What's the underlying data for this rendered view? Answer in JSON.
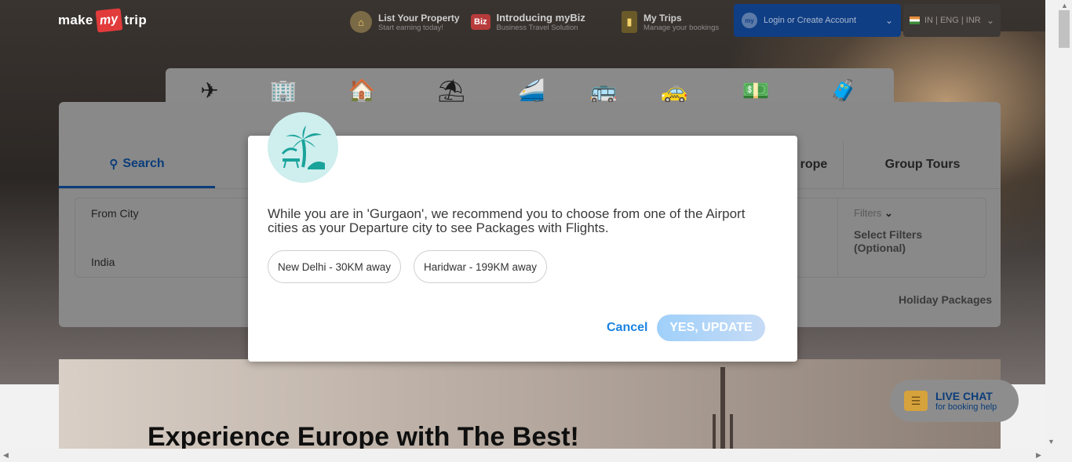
{
  "header": {
    "logo": {
      "make": "make",
      "my": "my",
      "trip": "trip"
    },
    "list_property": {
      "title": "List Your Property",
      "sub": "Start earning today!"
    },
    "mybiz": {
      "badge": "Biz",
      "title": "Introducing myBiz",
      "sub": "Business Travel Solution"
    },
    "my_trips": {
      "title": "My Trips",
      "sub": "Manage your bookings"
    },
    "login": {
      "avatar": "my",
      "label": "Login or Create Account"
    },
    "locale": {
      "label": "IN | ENG | INR"
    }
  },
  "nav_icons": [
    {
      "name": "flights-icon",
      "glyph": "✈"
    },
    {
      "name": "hotels-icon",
      "glyph": "🏢"
    },
    {
      "name": "homestays-icon",
      "glyph": "🏠"
    },
    {
      "name": "holiday-packages-icon",
      "glyph": "⛱"
    },
    {
      "name": "trains-icon",
      "glyph": "🚄"
    },
    {
      "name": "buses-icon",
      "glyph": "🚌"
    },
    {
      "name": "cabs-icon",
      "glyph": "🚕"
    },
    {
      "name": "forex-icon",
      "glyph": "💵"
    },
    {
      "name": "insurance-icon",
      "glyph": "🧳"
    }
  ],
  "panel": {
    "tabs": {
      "search": "Search",
      "europe_partial": "rope",
      "group_tours": "Group Tours"
    },
    "from_city": {
      "label": "From City",
      "value": "India"
    },
    "filters": {
      "label": "Filters",
      "value": "Select Filters (Optional)"
    },
    "package_type": "Holiday Packages"
  },
  "banner": {
    "title": "Experience Europe with The Best!"
  },
  "live_chat": {
    "title": "LIVE CHAT",
    "sub": "for booking help"
  },
  "modal": {
    "message": "While you are in 'Gurgaon', we recommend you to choose from one of the Airport cities as your Departure city to see Packages with Flights.",
    "options": [
      "New Delhi - 30KM away",
      "Haridwar - 199KM away"
    ],
    "cancel_label": "Cancel",
    "confirm_label": "YES, UPDATE"
  },
  "colors": {
    "accent": "#1a83e0",
    "badge_bg": "#cfeeee",
    "login_bg": "#0f3e84"
  }
}
